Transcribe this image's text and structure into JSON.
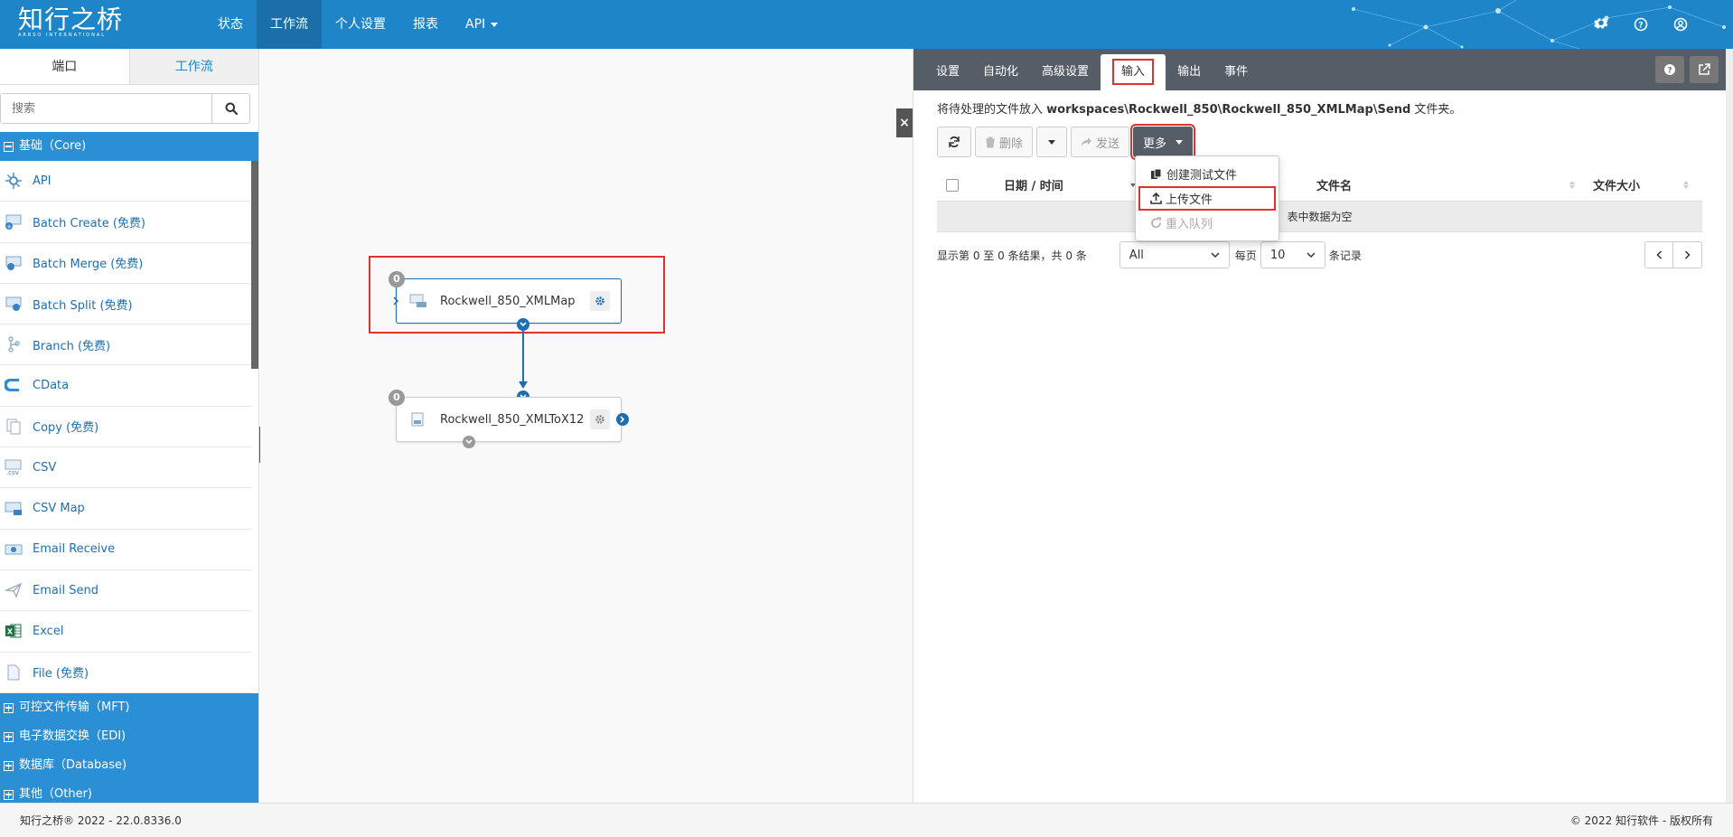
{
  "app": {
    "logo_text": "知行之桥",
    "logo_sub": "ARBSO INTERNATIONAL",
    "nav": [
      {
        "label": "状态"
      },
      {
        "label": "工作流"
      },
      {
        "label": "个人设置"
      },
      {
        "label": "报表"
      },
      {
        "label": "API"
      }
    ]
  },
  "sidebar": {
    "tabs": [
      {
        "label": "端口"
      },
      {
        "label": "工作流"
      }
    ],
    "search_placeholder": "搜索",
    "core_header": "基础（Core)",
    "items": [
      {
        "label": "API",
        "icon": "api-icon"
      },
      {
        "label": "Batch Create (免费)",
        "icon": "batch-create-icon"
      },
      {
        "label": "Batch Merge (免费)",
        "icon": "batch-merge-icon"
      },
      {
        "label": "Batch Split (免费)",
        "icon": "batch-split-icon"
      },
      {
        "label": "Branch (免费)",
        "icon": "branch-icon"
      },
      {
        "label": "CData",
        "icon": "cdata-icon"
      },
      {
        "label": "Copy (免费)",
        "icon": "copy-icon"
      },
      {
        "label": "CSV",
        "icon": "csv-icon"
      },
      {
        "label": "CSV Map",
        "icon": "csv-map-icon"
      },
      {
        "label": "Email Receive",
        "icon": "email-receive-icon"
      },
      {
        "label": "Email Send",
        "icon": "email-send-icon"
      },
      {
        "label": "Excel",
        "icon": "excel-icon"
      },
      {
        "label": "File (免费)",
        "icon": "file-icon"
      }
    ],
    "categories": [
      {
        "label": "可控文件传输（MFT)"
      },
      {
        "label": "电子数据交换（EDI)"
      },
      {
        "label": "数据库（Database)"
      },
      {
        "label": "其他（Other)"
      }
    ]
  },
  "canvas": {
    "nodes": [
      {
        "name": "Rockwell_850_XMLMap",
        "count": "0"
      },
      {
        "name": "Rockwell_850_XMLToX12",
        "count": "0"
      }
    ]
  },
  "panel": {
    "tabs": [
      {
        "label": "设置"
      },
      {
        "label": "自动化"
      },
      {
        "label": "高级设置"
      },
      {
        "label": "输入"
      },
      {
        "label": "输出"
      },
      {
        "label": "事件"
      }
    ],
    "info_prefix": "将待处理的文件放入 ",
    "info_path": "workspaces\\Rockwell_850\\Rockwell_850_XMLMap\\Send",
    "info_suffix": " 文件夹。",
    "toolbar": {
      "delete_label": "删除",
      "send_label": "发送",
      "more_label": "更多"
    },
    "table": {
      "columns": [
        "日期 / 时间",
        "文件名",
        "文件大小"
      ],
      "empty_text": "表中数据为空"
    },
    "pager": {
      "summary": "显示第 0 至 0 条结果，共 0 条",
      "filter_value": "All",
      "per_page_prefix": "每页",
      "per_page_value": "10",
      "per_page_suffix": "条记录"
    },
    "dropdown": [
      {
        "label": "创建测试文件",
        "icon": "copy-files-icon"
      },
      {
        "label": "上传文件",
        "icon": "upload-icon"
      },
      {
        "label": "重入队列",
        "icon": "requeue-icon"
      }
    ]
  },
  "footer": {
    "left": "知行之桥® 2022 - 22.0.8336.0",
    "right": "© 2022 知行软件 - 版权所有"
  },
  "colors": {
    "brand": "#1e86c8",
    "accent": "#2b8fd6",
    "highlight": "#e03030"
  }
}
